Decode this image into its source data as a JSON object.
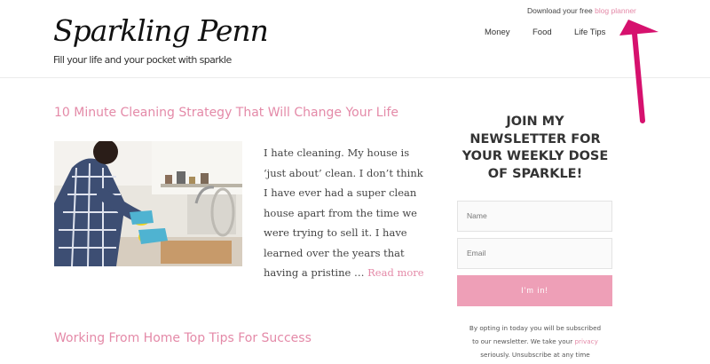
{
  "header": {
    "logo_text": "Sparkling Penny",
    "tagline": "Fill your life and your pocket with sparkle",
    "download_prefix": "Download your free",
    "download_link": "blog planner",
    "nav": [
      "Money",
      "Food",
      "Life Tips"
    ]
  },
  "posts": [
    {
      "title": "10 Minute Cleaning Strategy That Will Change Your Life",
      "excerpt_lines": [
        "I hate cleaning. My house is",
        "‘just about’ clean. I don’t think",
        "I have ever had a super clean",
        "house apart from the time we",
        "were trying to sell it. I have",
        "learned over the years that"
      ],
      "excerpt_last": "having a pristine …",
      "read_more": "Read more"
    },
    {
      "title": "Working From Home Top Tips For Success"
    }
  ],
  "newsletter": {
    "heading_lines": [
      "JOIN MY",
      "NEWSLETTER FOR",
      "YOUR WEEKLY DOSE",
      "OF SPARKLE!"
    ],
    "name_placeholder": "Name",
    "email_placeholder": "Email",
    "submit_label": "I'm in!",
    "optin_line1": "By opting in today you will be subscribed",
    "optin_line2_prefix": "to our newsletter. We take your",
    "optin_privacy": "privacy",
    "optin_line3": "seriously. Unsubscribe at any time"
  },
  "colors": {
    "accent_pink": "#e48aa8",
    "button_pink": "#ee9fb7",
    "arrow_magenta": "#d6116e",
    "text_dark": "#333333"
  },
  "icons": {
    "annotation_arrow": "arrow-up-icon"
  }
}
